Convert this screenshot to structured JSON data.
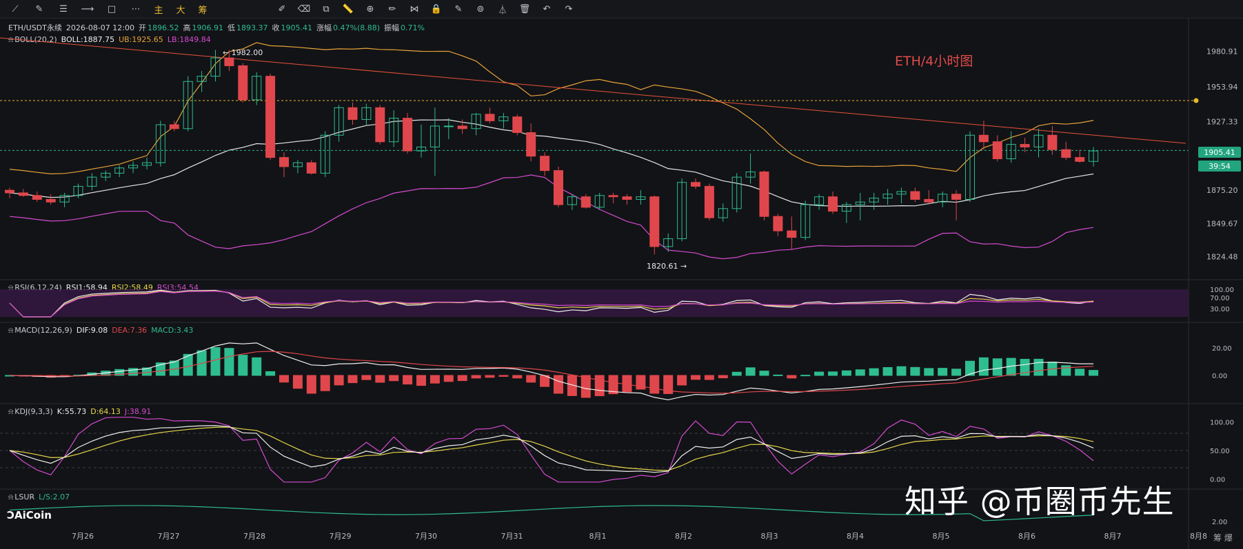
{
  "toolbar": {
    "cn_buttons": [
      "主",
      "大",
      "筹"
    ]
  },
  "header": {
    "symbol": "ETH/USDT永续",
    "datetime": "2026-08-07 12:00",
    "open_label": "开",
    "open": "1896.52",
    "high_label": "高",
    "high": "1906.91",
    "low_label": "低",
    "low": "1893.37",
    "close_label": "收",
    "close": "1905.41",
    "change_label": "涨幅",
    "change": "0.47%(8.88)",
    "amp_label": "振幅",
    "amp": "0.71%"
  },
  "indicators": {
    "boll": {
      "name": "BOLL(20,2)",
      "mid": "BOLL:1887.75",
      "ub": "UB:1925.65",
      "lb": "LB:1849.84"
    },
    "rsi": {
      "name": "RSI(6,12,24)",
      "rsi1": "RSI1:58.94",
      "rsi2": "RSI2:58.49",
      "rsi3": "RSI3:54.54"
    },
    "macd": {
      "name": "MACD(12,26,9)",
      "dif": "DIF:9.08",
      "dea": "DEA:7.36",
      "macd": "MACD:3.43"
    },
    "kdj": {
      "name": "KDJ(9,3,3)",
      "k": "K:55.73",
      "d": "D:64.13",
      "j": "J:38.91"
    },
    "lsur": {
      "name": "LSUR",
      "ls": "L/S:2.07"
    }
  },
  "annotations": {
    "title": "ETH/4小时图",
    "high_marker": "← 1982.00",
    "low_marker": "1820.61 →",
    "current_price": "1905.41",
    "countdown": "39:54"
  },
  "watermark": "知乎 @币圈币先生",
  "logo": "AiCoin",
  "corner": "筹 爆",
  "colors": {
    "up": "#2ebd8f",
    "down": "#e0474c",
    "boll_mid": "#e6e6e6",
    "boll_ub": "#e8a33a",
    "boll_lb": "#d54bd2",
    "trend": "#e8533b"
  },
  "chart_data": {
    "type": "candlestick",
    "timeframe": "4h",
    "x_tick_labels": [
      "7月26",
      "7月27",
      "7月28",
      "7月29",
      "7月30",
      "7月31",
      "8月1",
      "8月2",
      "8月3",
      "8月4",
      "8月5",
      "8月6",
      "8月7",
      "8月8"
    ],
    "price_axis": [
      1980.91,
      1953.94,
      1927.33,
      1875.2,
      1849.67,
      1824.48
    ],
    "ylim": [
      1812,
      1996
    ],
    "candles": [
      [
        1875,
        1877,
        1869,
        1873
      ],
      [
        1873,
        1876,
        1870,
        1871
      ],
      [
        1871,
        1874,
        1866,
        1868
      ],
      [
        1868,
        1872,
        1864,
        1866
      ],
      [
        1866,
        1873,
        1862,
        1871
      ],
      [
        1871,
        1880,
        1869,
        1878
      ],
      [
        1878,
        1888,
        1875,
        1885
      ],
      [
        1885,
        1890,
        1882,
        1888
      ],
      [
        1888,
        1894,
        1885,
        1892
      ],
      [
        1892,
        1897,
        1888,
        1894
      ],
      [
        1894,
        1900,
        1891,
        1896
      ],
      [
        1896,
        1928,
        1893,
        1925
      ],
      [
        1925,
        1928,
        1920,
        1922
      ],
      [
        1922,
        1962,
        1920,
        1958
      ],
      [
        1958,
        1966,
        1950,
        1962
      ],
      [
        1962,
        1982,
        1958,
        1976
      ],
      [
        1976,
        1982,
        1966,
        1970
      ],
      [
        1970,
        1972,
        1942,
        1944
      ],
      [
        1944,
        1965,
        1940,
        1962
      ],
      [
        1962,
        1964,
        1898,
        1900
      ],
      [
        1900,
        1904,
        1885,
        1893
      ],
      [
        1893,
        1898,
        1888,
        1896
      ],
      [
        1896,
        1898,
        1887,
        1888
      ],
      [
        1888,
        1920,
        1885,
        1917
      ],
      [
        1917,
        1940,
        1912,
        1938
      ],
      [
        1938,
        1942,
        1925,
        1929
      ],
      [
        1929,
        1941,
        1925,
        1938
      ],
      [
        1938,
        1940,
        1910,
        1912
      ],
      [
        1912,
        1936,
        1908,
        1930
      ],
      [
        1930,
        1934,
        1903,
        1905
      ],
      [
        1905,
        1925,
        1900,
        1908
      ],
      [
        1908,
        1938,
        1886,
        1924
      ],
      [
        1924,
        1930,
        1914,
        1924
      ],
      [
        1924,
        1929,
        1918,
        1922
      ],
      [
        1922,
        1934,
        1917,
        1933
      ],
      [
        1933,
        1938,
        1926,
        1928
      ],
      [
        1928,
        1934,
        1922,
        1931
      ],
      [
        1931,
        1933,
        1917,
        1919
      ],
      [
        1919,
        1926,
        1897,
        1901
      ],
      [
        1901,
        1904,
        1886,
        1890
      ],
      [
        1890,
        1893,
        1862,
        1864
      ],
      [
        1864,
        1872,
        1860,
        1870
      ],
      [
        1870,
        1872,
        1861,
        1862
      ],
      [
        1862,
        1873,
        1860,
        1871
      ],
      [
        1871,
        1873,
        1865,
        1870
      ],
      [
        1870,
        1872,
        1864,
        1868
      ],
      [
        1868,
        1875,
        1864,
        1870
      ],
      [
        1870,
        1871,
        1826,
        1832
      ],
      [
        1832,
        1842,
        1828,
        1838
      ],
      [
        1838,
        1884,
        1836,
        1881
      ],
      [
        1881,
        1884,
        1876,
        1878
      ],
      [
        1878,
        1880,
        1852,
        1854
      ],
      [
        1854,
        1865,
        1851,
        1861
      ],
      [
        1861,
        1888,
        1858,
        1885
      ],
      [
        1885,
        1903,
        1880,
        1889
      ],
      [
        1889,
        1890,
        1852,
        1855
      ],
      [
        1855,
        1857,
        1840,
        1844
      ],
      [
        1844,
        1855,
        1830,
        1839
      ],
      [
        1839,
        1867,
        1837,
        1864
      ],
      [
        1864,
        1872,
        1860,
        1870
      ],
      [
        1870,
        1874,
        1857,
        1859
      ],
      [
        1859,
        1866,
        1850,
        1864
      ],
      [
        1864,
        1873,
        1852,
        1866
      ],
      [
        1866,
        1873,
        1860,
        1869
      ],
      [
        1869,
        1876,
        1864,
        1872
      ],
      [
        1872,
        1877,
        1865,
        1874
      ],
      [
        1874,
        1877,
        1866,
        1868
      ],
      [
        1868,
        1875,
        1864,
        1866
      ],
      [
        1866,
        1874,
        1862,
        1872
      ],
      [
        1872,
        1875,
        1852,
        1868
      ],
      [
        1868,
        1920,
        1866,
        1917
      ],
      [
        1917,
        1928,
        1906,
        1912
      ],
      [
        1912,
        1917,
        1897,
        1899
      ],
      [
        1899,
        1920,
        1896,
        1910
      ],
      [
        1910,
        1915,
        1904,
        1908
      ],
      [
        1908,
        1922,
        1900,
        1917
      ],
      [
        1917,
        1924,
        1902,
        1906
      ],
      [
        1906,
        1912,
        1898,
        1900
      ],
      [
        1900,
        1906,
        1896,
        1897
      ],
      [
        1897,
        1908,
        1893,
        1905
      ]
    ]
  }
}
